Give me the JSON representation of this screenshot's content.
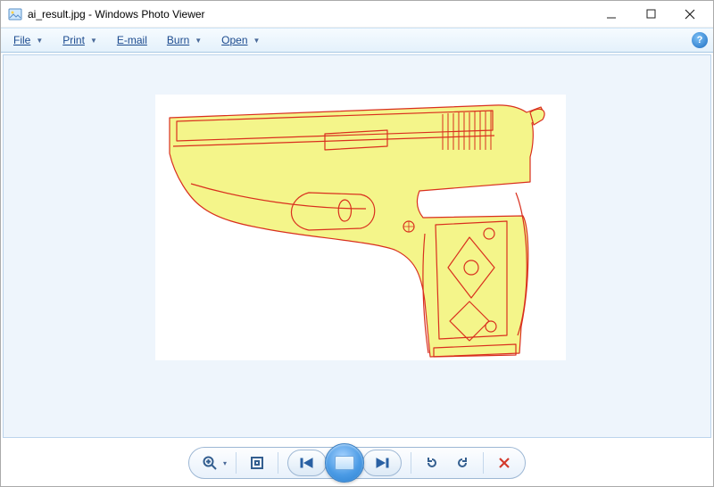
{
  "window": {
    "filename": "ai_result.jpg",
    "appname": "Windows Photo Viewer",
    "title": "ai_result.jpg - Windows Photo Viewer"
  },
  "menu": {
    "file": "File",
    "print": "Print",
    "email": "E-mail",
    "burn": "Burn",
    "open": "Open"
  },
  "toolbar": {
    "zoom": "Zoom",
    "fit": "Fit to window",
    "prev": "Previous",
    "slideshow": "Play slide show",
    "next": "Next",
    "rotate_ccw": "Rotate counterclockwise",
    "rotate_cw": "Rotate clockwise",
    "delete": "Delete"
  },
  "image": {
    "description": "ai_result.jpg displayed — edge-detection / line-art rendering of a semi-automatic pistol, yellow fill with red outline, on white background"
  },
  "help": {
    "label": "?"
  }
}
